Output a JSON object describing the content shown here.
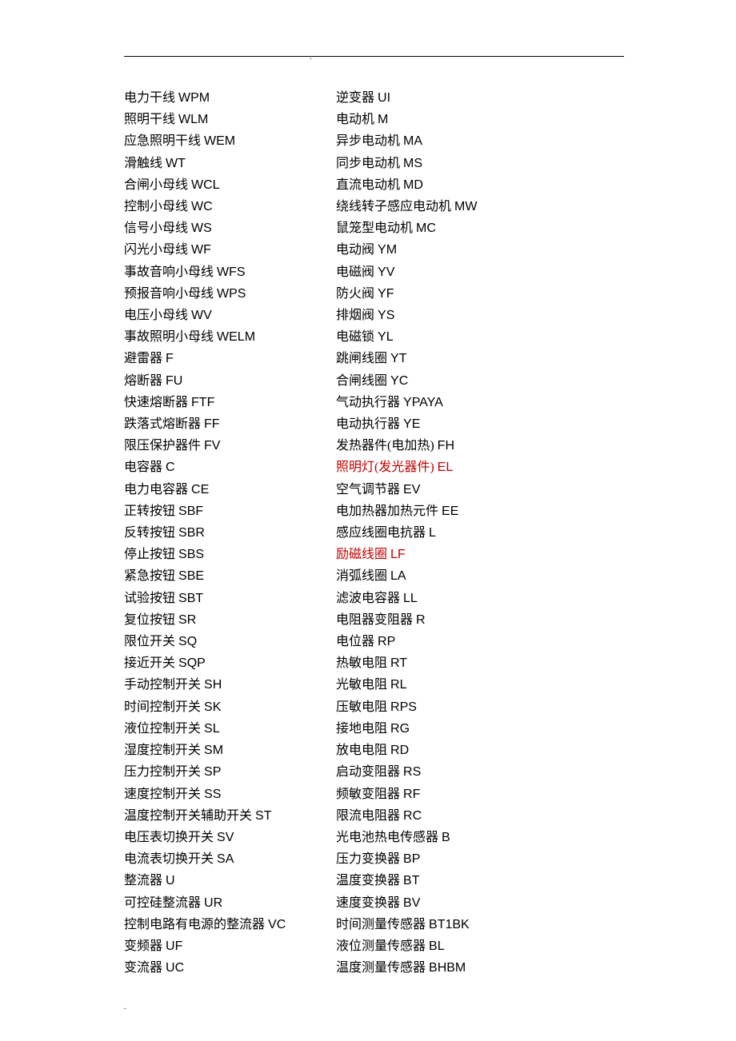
{
  "left": [
    {
      "name": "电力干线",
      "code": "WPM"
    },
    {
      "name": "照明干线",
      "code": "WLM"
    },
    {
      "name": "应急照明干线",
      "code": "WEM"
    },
    {
      "name": "滑触线",
      "code": "WT"
    },
    {
      "name": "合闸小母线",
      "code": "WCL"
    },
    {
      "name": "控制小母线",
      "code": "WC"
    },
    {
      "name": "信号小母线",
      "code": "WS"
    },
    {
      "name": "闪光小母线",
      "code": "WF"
    },
    {
      "name": "事故音响小母线",
      "code": "WFS"
    },
    {
      "name": "预报音响小母线",
      "code": "WPS"
    },
    {
      "name": "电压小母线",
      "code": "WV"
    },
    {
      "name": "事故照明小母线",
      "code": "WELM"
    },
    {
      "name": "避雷器",
      "code": "F"
    },
    {
      "name": "熔断器",
      "code": "FU"
    },
    {
      "name": "快速熔断器",
      "code": "FTF"
    },
    {
      "name": "跌落式熔断器",
      "code": "FF"
    },
    {
      "name": "限压保护器件",
      "code": "FV"
    },
    {
      "name": "电容器",
      "code": "C"
    },
    {
      "name": "电力电容器",
      "code": "CE"
    },
    {
      "name": "正转按钮",
      "code": "SBF"
    },
    {
      "name": "反转按钮",
      "code": "SBR"
    },
    {
      "name": "停止按钮",
      "code": "SBS"
    },
    {
      "name": "紧急按钮",
      "code": "SBE"
    },
    {
      "name": "试验按钮",
      "code": "SBT"
    },
    {
      "name": "复位按钮",
      "code": "SR"
    },
    {
      "name": "限位开关",
      "code": "SQ"
    },
    {
      "name": "接近开关",
      "code": "SQP"
    },
    {
      "name": "手动控制开关",
      "code": "SH"
    },
    {
      "name": "时间控制开关",
      "code": "SK"
    },
    {
      "name": "液位控制开关",
      "code": "SL"
    },
    {
      "name": "湿度控制开关",
      "code": "SM"
    },
    {
      "name": "压力控制开关",
      "code": "SP"
    },
    {
      "name": "速度控制开关",
      "code": "SS"
    },
    {
      "name": "温度控制开关辅助开关",
      "code": "ST"
    },
    {
      "name": "电压表切换开关",
      "code": "SV"
    },
    {
      "name": "电流表切换开关",
      "code": "SA"
    },
    {
      "name": "整流器",
      "code": "U"
    },
    {
      "name": "可控硅整流器",
      "code": "UR"
    },
    {
      "name": "控制电路有电源的整流器",
      "code": "VC"
    },
    {
      "name": "变频器",
      "code": "UF"
    },
    {
      "name": "变流器",
      "code": "UC"
    }
  ],
  "right": [
    {
      "name": "逆变器",
      "code": "UI"
    },
    {
      "name": "电动机",
      "code": "M"
    },
    {
      "name": "异步电动机",
      "code": "MA"
    },
    {
      "name": "同步电动机",
      "code": "MS"
    },
    {
      "name": "直流电动机",
      "code": "MD"
    },
    {
      "name": "绕线转子感应电动机",
      "code": "MW"
    },
    {
      "name": "鼠笼型电动机",
      "code": "MC"
    },
    {
      "name": "电动阀",
      "code": "YM"
    },
    {
      "name": "电磁阀",
      "code": "YV"
    },
    {
      "name": "防火阀",
      "code": "YF"
    },
    {
      "name": "排烟阀",
      "code": "YS"
    },
    {
      "name": "电磁锁",
      "code": "YL"
    },
    {
      "name": "跳闸线圈",
      "code": "YT"
    },
    {
      "name": "合闸线圈",
      "code": "YC"
    },
    {
      "name": "气动执行器",
      "code": "YPAYA"
    },
    {
      "name": "电动执行器",
      "code": "YE"
    },
    {
      "name": "发热器件(电加热)",
      "code": "FH"
    },
    {
      "name": "照明灯(发光器件)",
      "code": "EL",
      "red": true
    },
    {
      "name": "空气调节器",
      "code": "EV"
    },
    {
      "name": "电加热器加热元件",
      "code": "EE"
    },
    {
      "name": "感应线圈电抗器",
      "code": "L"
    },
    {
      "name": "励磁线圈",
      "code": "LF",
      "red": true
    },
    {
      "name": "消弧线圈",
      "code": "LA"
    },
    {
      "name": "滤波电容器",
      "code": "LL"
    },
    {
      "name": "电阻器变阻器",
      "code": "R"
    },
    {
      "name": "电位器",
      "code": "RP"
    },
    {
      "name": "热敏电阻",
      "code": "RT"
    },
    {
      "name": "光敏电阻",
      "code": "RL"
    },
    {
      "name": "压敏电阻",
      "code": "RPS"
    },
    {
      "name": "接地电阻",
      "code": "RG"
    },
    {
      "name": "放电电阻",
      "code": "RD"
    },
    {
      "name": "启动变阻器",
      "code": "RS"
    },
    {
      "name": "频敏变阻器",
      "code": "RF"
    },
    {
      "name": "限流电阻器",
      "code": "RC"
    },
    {
      "name": "光电池热电传感器",
      "code": "B"
    },
    {
      "name": "压力变换器",
      "code": "BP"
    },
    {
      "name": "温度变换器",
      "code": "BT"
    },
    {
      "name": "速度变换器",
      "code": "BV"
    },
    {
      "name": "时间测量传感器",
      "code": "BT1BK"
    },
    {
      "name": "液位测量传感器",
      "code": "BL"
    },
    {
      "name": "温度测量传感器",
      "code": "BHBM"
    }
  ]
}
